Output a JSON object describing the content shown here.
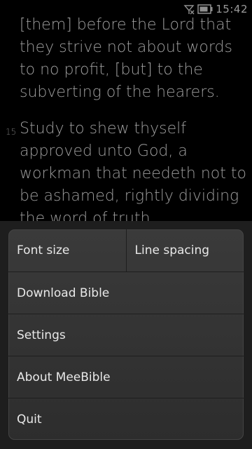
{
  "status": {
    "time": "15:42",
    "icons": [
      "no-signal-icon",
      "battery-icon"
    ]
  },
  "reader": {
    "paragraph_1": "[them] before the Lord that they strive not about words to no profit, [but] to the subverting of the hearers.",
    "verse_number": "15",
    "paragraph_2": "Study to shew thyself approved unto God, a workman that needeth not to be ashamed, rightly dividing the word of truth."
  },
  "menu": {
    "font_size": "Font size",
    "line_spacing": "Line spacing",
    "download_bible": "Download Bible",
    "settings": "Settings",
    "about": "About MeeBible",
    "quit": "Quit"
  },
  "colors": {
    "background": "#000000",
    "text": "#9d9d9d",
    "menu_bg": "#333333",
    "menu_text": "#e8e8e8"
  }
}
